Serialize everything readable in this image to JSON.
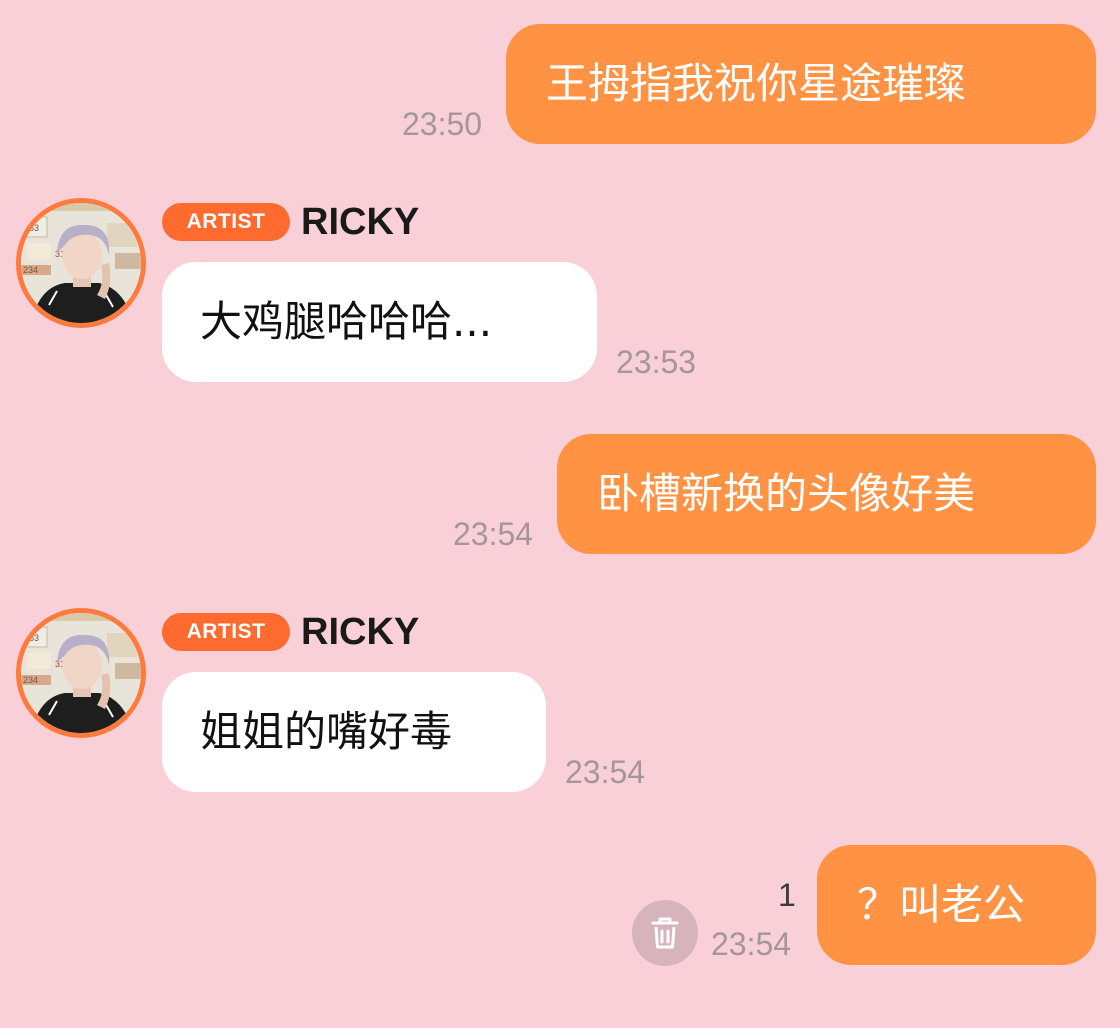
{
  "messages": [
    {
      "sender": "me",
      "text": "王拇指我祝你星途璀璨",
      "time": "23:50"
    },
    {
      "sender": "artist",
      "badge": "ARTIST",
      "name": "RICKY",
      "text": "大鸡腿哈哈哈...",
      "time": "23:53"
    },
    {
      "sender": "me",
      "text": "卧槽新换的头像好美",
      "time": "23:54"
    },
    {
      "sender": "artist",
      "badge": "ARTIST",
      "name": "RICKY",
      "text": "姐姐的嘴好毒",
      "time": "23:54"
    },
    {
      "sender": "me",
      "text": "？叫老公",
      "time": "23:54",
      "unread_count": "1"
    }
  ],
  "icons": {
    "delete": "trash-icon",
    "avatar": "artist-avatar-photo"
  },
  "colors": {
    "background": "#F9D0D8",
    "my_bubble": "#FF9243",
    "artist_bubble": "#FFFFFF",
    "artist_badge": "#FF6A2F",
    "avatar_ring": "#FF7A3D",
    "timestamp": "#A4969B"
  }
}
